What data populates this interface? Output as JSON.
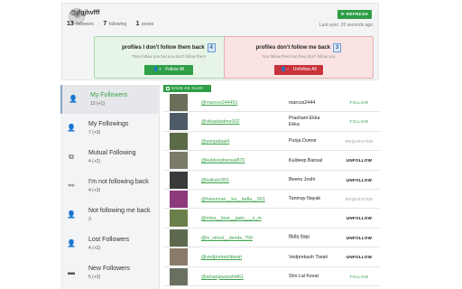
{
  "profile": {
    "username": "@jfgjhvfff",
    "followers_count": "13",
    "followers_label": "followers",
    "following_count": "7",
    "following_label": "following",
    "posts_count": "1",
    "posts_label": "poses",
    "refresh_label": "REFRESH",
    "last_sync": "Last sync: 20 seconds ago"
  },
  "panels": {
    "not_following_back": {
      "title": "profiles I don't follow them back",
      "count": "4",
      "subtitle": "They follow you but you don't follow them",
      "button": "Follow All"
    },
    "dont_follow_me_back": {
      "title": "profiles don't follow me back",
      "count": "3",
      "subtitle": "You follow them but they don't follow you",
      "button": "Unfollow All"
    }
  },
  "sidebar": {
    "items": [
      {
        "label": "My Followers",
        "count": "13 (+1)",
        "icon": "followers-icon"
      },
      {
        "label": "My Followings",
        "count": "7 (+3)",
        "icon": "followings-icon"
      },
      {
        "label": "Mutual Following",
        "count": "4 (+2)",
        "icon": "mutual-icon"
      },
      {
        "label": "I'm not following back",
        "count": "4 (+3)",
        "icon": "not-following-back-icon"
      },
      {
        "label": "Not following me back",
        "count": "3",
        "icon": "not-following-me-icon"
      },
      {
        "label": "Lost Followers",
        "count": "4 (+2)",
        "icon": "lost-followers-icon"
      },
      {
        "label": "New Followers",
        "count": "6 (+3)",
        "icon": "new-followers-icon"
      }
    ]
  },
  "table": {
    "save_label": "SAVE AS XLSX",
    "rows": [
      {
        "handle": "@marcos244451",
        "name": "marcos2444",
        "action": "FOLLOW",
        "kind": "follow",
        "thumb": "#6a6f5a"
      },
      {
        "handle": "@vikasbadme302",
        "name": "Prashant Ekka Ekka",
        "action": "FOLLOW",
        "kind": "follow",
        "thumb": "#4e5b66"
      },
      {
        "handle": "@punjadaal4",
        "name": "Punja Dumor",
        "action": "REQUESTED",
        "kind": "requested",
        "thumb": "#5b6b48"
      },
      {
        "handle": "@kuldeepbansal870",
        "name": "Kuldeep Bansal",
        "action": "UNFOLLOW",
        "kind": "unfollow",
        "thumb": "#7b7a6a"
      },
      {
        "handle": "@kallubri351",
        "name": "Beenu Joshi",
        "action": "UNFOLLOW",
        "kind": "unfollow",
        "thumb": "#3a3a3a"
      },
      {
        "handle": "@hanuman__ka__ladla__951",
        "name": "Tanmay Nayak",
        "action": "REQUESTED",
        "kind": "requested",
        "thumb": "#8c3a7c"
      },
      {
        "handle": "@miss__love__jaan___s_m",
        "name": "",
        "action": "UNFOLLOW",
        "kind": "unfollow",
        "thumb": "#6b7f4a"
      },
      {
        "handle": "@lx_vinod__devda_750",
        "name": "विनोद देवड़ा",
        "action": "UNFOLLOW",
        "kind": "unfollow",
        "thumb": "#5e6a4e"
      },
      {
        "handle": "@vedprekashtiwari",
        "name": "Vedprekash Tiwari",
        "action": "UNFOLLOW",
        "kind": "unfollow",
        "thumb": "#8a7a68"
      },
      {
        "handle": "@amanjavanshi461",
        "name": "Shri Lal Kevat",
        "action": "FOLLOW",
        "kind": "follow",
        "thumb": "#6a7060"
      }
    ]
  }
}
